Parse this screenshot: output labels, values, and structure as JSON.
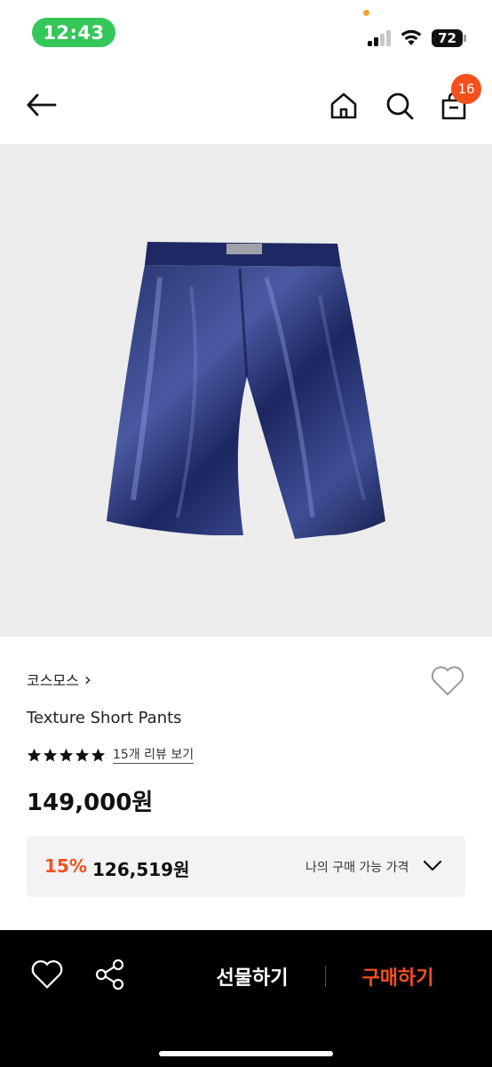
{
  "status_bar": {
    "time": "12:43",
    "battery": "72"
  },
  "nav": {
    "back_icon": "arrow-left-icon",
    "home_icon": "home-icon",
    "search_icon": "search-icon",
    "cart_icon": "shopping-bag-icon",
    "cart_count": "16"
  },
  "product": {
    "image_alt": "Texture Short Pants",
    "brand": "코스모스",
    "brand_chevron": "›",
    "name": "Texture Short Pants",
    "rating_stars": 5,
    "review_link": "15개 리뷰 보기",
    "price": "149,000원"
  },
  "my_price": {
    "discount_rate": "15%",
    "discount_price": "126,519원",
    "label": "나의 구매 가능 가격"
  },
  "bottom_bar": {
    "gift_label": "선물하기",
    "buy_label": "구매하기"
  },
  "colors": {
    "accent": "#f4501e",
    "status_pill": "#34c759",
    "image_bg": "#ececec",
    "price_box_bg": "#f3f3f3"
  }
}
